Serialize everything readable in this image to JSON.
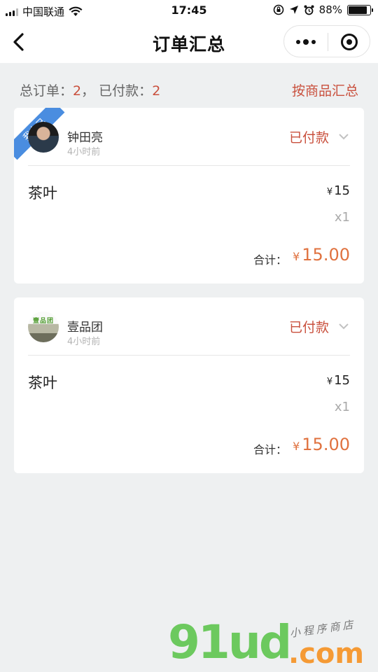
{
  "status_bar": {
    "carrier": "中国联通",
    "time": "17:45",
    "battery": "88%",
    "battery_level": 0.88
  },
  "nav": {
    "title": "订单汇总"
  },
  "summary": {
    "total_label": "总订单：",
    "total_value": "2",
    "separator": "，",
    "paid_label": "已付款：",
    "paid_value": "2",
    "group_button": "按商品汇总"
  },
  "orders": [
    {
      "badge": "我自己",
      "buyer": "钟田亮",
      "time_ago": "4小时前",
      "status": "已付款",
      "item_name": "茶叶",
      "currency": "¥",
      "price": "15",
      "qty": "x1",
      "total_label": "合计：",
      "total": "15.00"
    },
    {
      "buyer": "壹品团",
      "avatar_text": "壹品团",
      "time_ago": "4小时前",
      "status": "已付款",
      "item_name": "茶叶",
      "currency": "¥",
      "price": "15",
      "qty": "x1",
      "total_label": "合计：",
      "total": "15.00"
    }
  ],
  "watermark": {
    "main": "91ud",
    "domain": ".com",
    "tagline": "小程序商店"
  },
  "colors": {
    "accent_red": "#c9503d",
    "amount_orange": "#e0723f",
    "ribbon_blue": "#4a8de0",
    "background": "#eef0f1"
  }
}
